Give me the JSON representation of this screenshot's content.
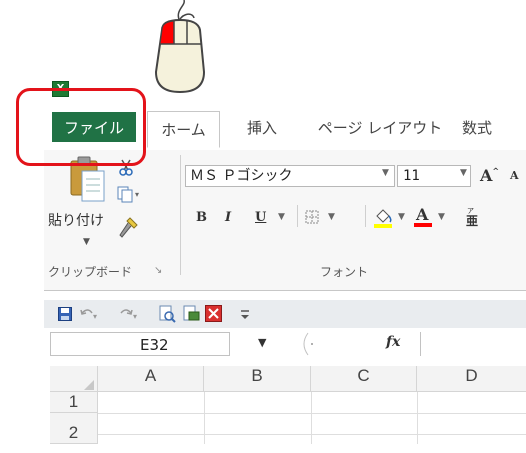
{
  "ribbon": {
    "tabs": {
      "file": "ファイル",
      "home": "ホーム",
      "insert": "挿入",
      "page_layout": "ページ レイアウト",
      "formulas": "数式"
    },
    "clipboard": {
      "paste_label": "貼り付け",
      "group_label": "クリップボード"
    },
    "font": {
      "font_name": "ＭＳ Ｐゴシック",
      "font_size": "11",
      "group_label": "フォント",
      "bold": "B",
      "italic": "I",
      "underline": "U"
    }
  },
  "formula_bar": {
    "name_box_value": "E32",
    "fx_label": "fx",
    "formula_value": ""
  },
  "grid": {
    "columns": [
      "A",
      "B",
      "C",
      "D"
    ],
    "rows": [
      "1",
      "2"
    ]
  },
  "colors": {
    "file_tab": "#207245",
    "highlight": "#e3131a"
  }
}
